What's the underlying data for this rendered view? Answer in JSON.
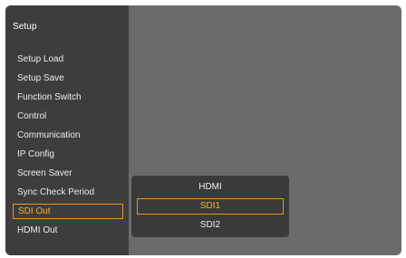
{
  "sidebar": {
    "title": "Setup",
    "items": [
      {
        "label": "Setup Load"
      },
      {
        "label": "Setup Save"
      },
      {
        "label": "Function Switch"
      },
      {
        "label": "Control"
      },
      {
        "label": "Communication"
      },
      {
        "label": "IP Config"
      },
      {
        "label": "Screen Saver"
      },
      {
        "label": "Sync Check Period"
      },
      {
        "label": "SDI Out"
      },
      {
        "label": "HDMI Out"
      }
    ]
  },
  "popup": {
    "options": [
      {
        "label": "HDMI"
      },
      {
        "label": "SDI1"
      },
      {
        "label": "SDI2"
      }
    ]
  },
  "colors": {
    "highlight_text": "#f2b521",
    "highlight_border": "#e8951d",
    "sidebar_bg": "#3d3d3d",
    "content_bg": "#6b6b6b",
    "popup_bg": "#3a3a3a"
  }
}
